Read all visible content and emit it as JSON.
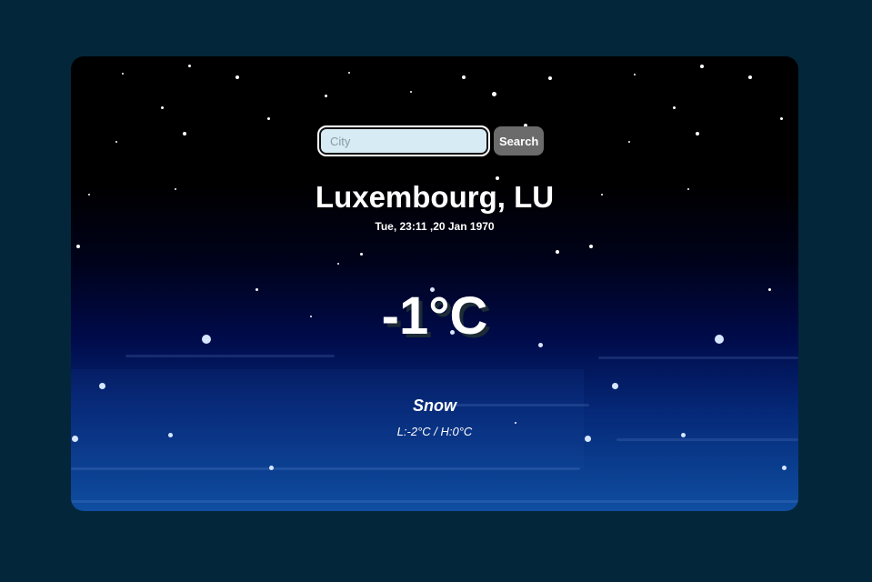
{
  "search": {
    "placeholder": "City",
    "value": "",
    "button_label": "Search"
  },
  "weather": {
    "location": "Luxembourg, LU",
    "datetime": "Tue, 23:11 ,20 Jan 1970",
    "temperature": "-1°C",
    "condition": "Snow",
    "low_high": "L:-2°C / H:0°C"
  },
  "colors": {
    "page_background": "#03263a",
    "input_background": "#d7ebf5",
    "button_background": "#6b6b6b",
    "text": "#ffffff"
  }
}
